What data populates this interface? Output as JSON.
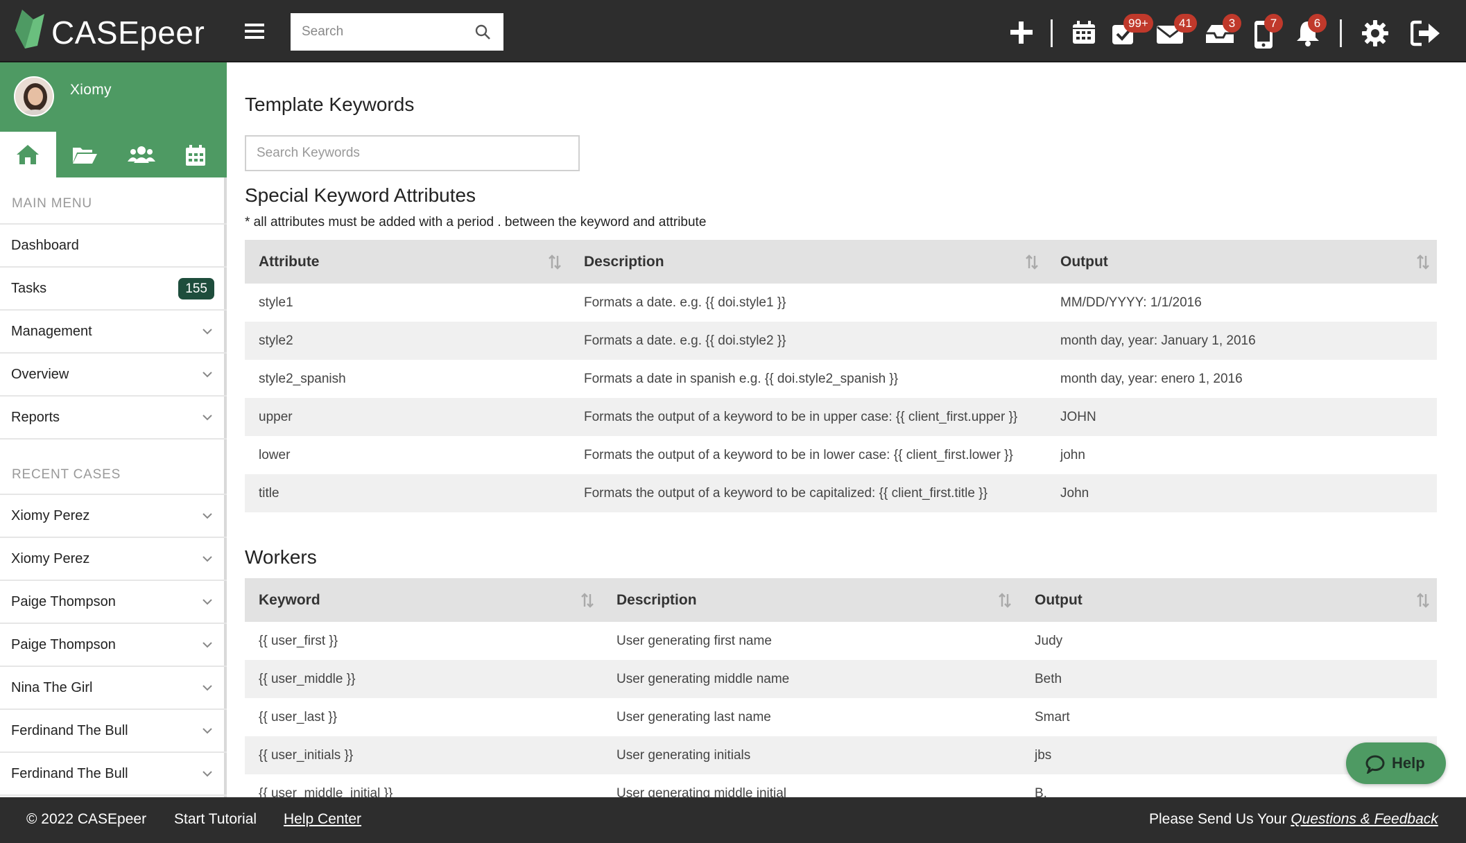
{
  "app": {
    "brand": "CASEpeer",
    "brand_color": "#4e9a63",
    "topbar_color": "#2d2d2d"
  },
  "topbar": {
    "search_placeholder": "Search",
    "icons": [
      {
        "name": "add-icon"
      },
      {
        "name": "calendar-icon"
      },
      {
        "name": "tasks-check-icon",
        "badge": "99+"
      },
      {
        "name": "mail-icon",
        "badge": "41"
      },
      {
        "name": "inbox-icon",
        "badge": "3"
      },
      {
        "name": "phone-icon",
        "badge": "7"
      },
      {
        "name": "bell-icon",
        "badge": "6"
      },
      {
        "name": "settings-gear-icon"
      },
      {
        "name": "logout-icon"
      }
    ]
  },
  "sidebar": {
    "user_name": "Xiomy",
    "quick_tabs": [
      "home-icon",
      "folder-open-icon",
      "users-icon",
      "calendar-icon"
    ],
    "main_menu_label": "MAIN MENU",
    "main_menu": [
      {
        "label": "Dashboard"
      },
      {
        "label": "Tasks",
        "count": "155"
      },
      {
        "label": "Management"
      },
      {
        "label": "Overview"
      },
      {
        "label": "Reports"
      }
    ],
    "recent_cases_label": "RECENT CASES",
    "recent_cases": [
      {
        "label": "Xiomy Perez"
      },
      {
        "label": "Xiomy Perez"
      },
      {
        "label": "Paige Thompson"
      },
      {
        "label": "Paige Thompson"
      },
      {
        "label": "Nina The Girl"
      },
      {
        "label": "Ferdinand The Bull"
      },
      {
        "label": "Ferdinand The Bull"
      }
    ]
  },
  "main": {
    "title": "Template Keywords",
    "search_placeholder": "Search Keywords",
    "special": {
      "title": "Special Keyword Attributes",
      "note": "* all attributes must be added with a period . between the keyword and attribute",
      "headers": [
        "Attribute",
        "Description",
        "Output"
      ],
      "rows": [
        [
          "style1",
          "Formats a date. e.g. {{ doi.style1 }}",
          "MM/DD/YYYY: 1/1/2016"
        ],
        [
          "style2",
          "Formats a date. e.g. {{ doi.style2 }}",
          "month day, year: January 1, 2016"
        ],
        [
          "style2_spanish",
          "Formats a date in spanish e.g. {{ doi.style2_spanish }}",
          "month day, year: enero 1, 2016"
        ],
        [
          "upper",
          "Formats the output of a keyword to be in upper case: {{ client_first.upper }}",
          "JOHN"
        ],
        [
          "lower",
          "Formats the output of a keyword to be in lower case: {{ client_first.lower }}",
          "john"
        ],
        [
          "title",
          "Formats the output of a keyword to be capitalized: {{ client_first.title }}",
          "John"
        ]
      ]
    },
    "workers": {
      "title": "Workers",
      "headers": [
        "Keyword",
        "Description",
        "Output"
      ],
      "rows": [
        [
          "{{ user_first }}",
          "User generating first name",
          "Judy"
        ],
        [
          "{{ user_middle }}",
          "User generating middle name",
          "Beth"
        ],
        [
          "{{ user_last }}",
          "User generating last name",
          "Smart"
        ],
        [
          "{{ user_initials }}",
          "User generating initials",
          "jbs"
        ],
        [
          "{{ user_middle_initial }}",
          "User generating middle initial",
          "B."
        ]
      ]
    }
  },
  "help": {
    "label": "Help"
  },
  "footer": {
    "copyright": "© 2022 CASEpeer",
    "tutorial": "Start Tutorial",
    "help_center": "Help Center",
    "feedback_prefix": "Please Send Us Your",
    "feedback_link": "Questions & Feedback"
  }
}
